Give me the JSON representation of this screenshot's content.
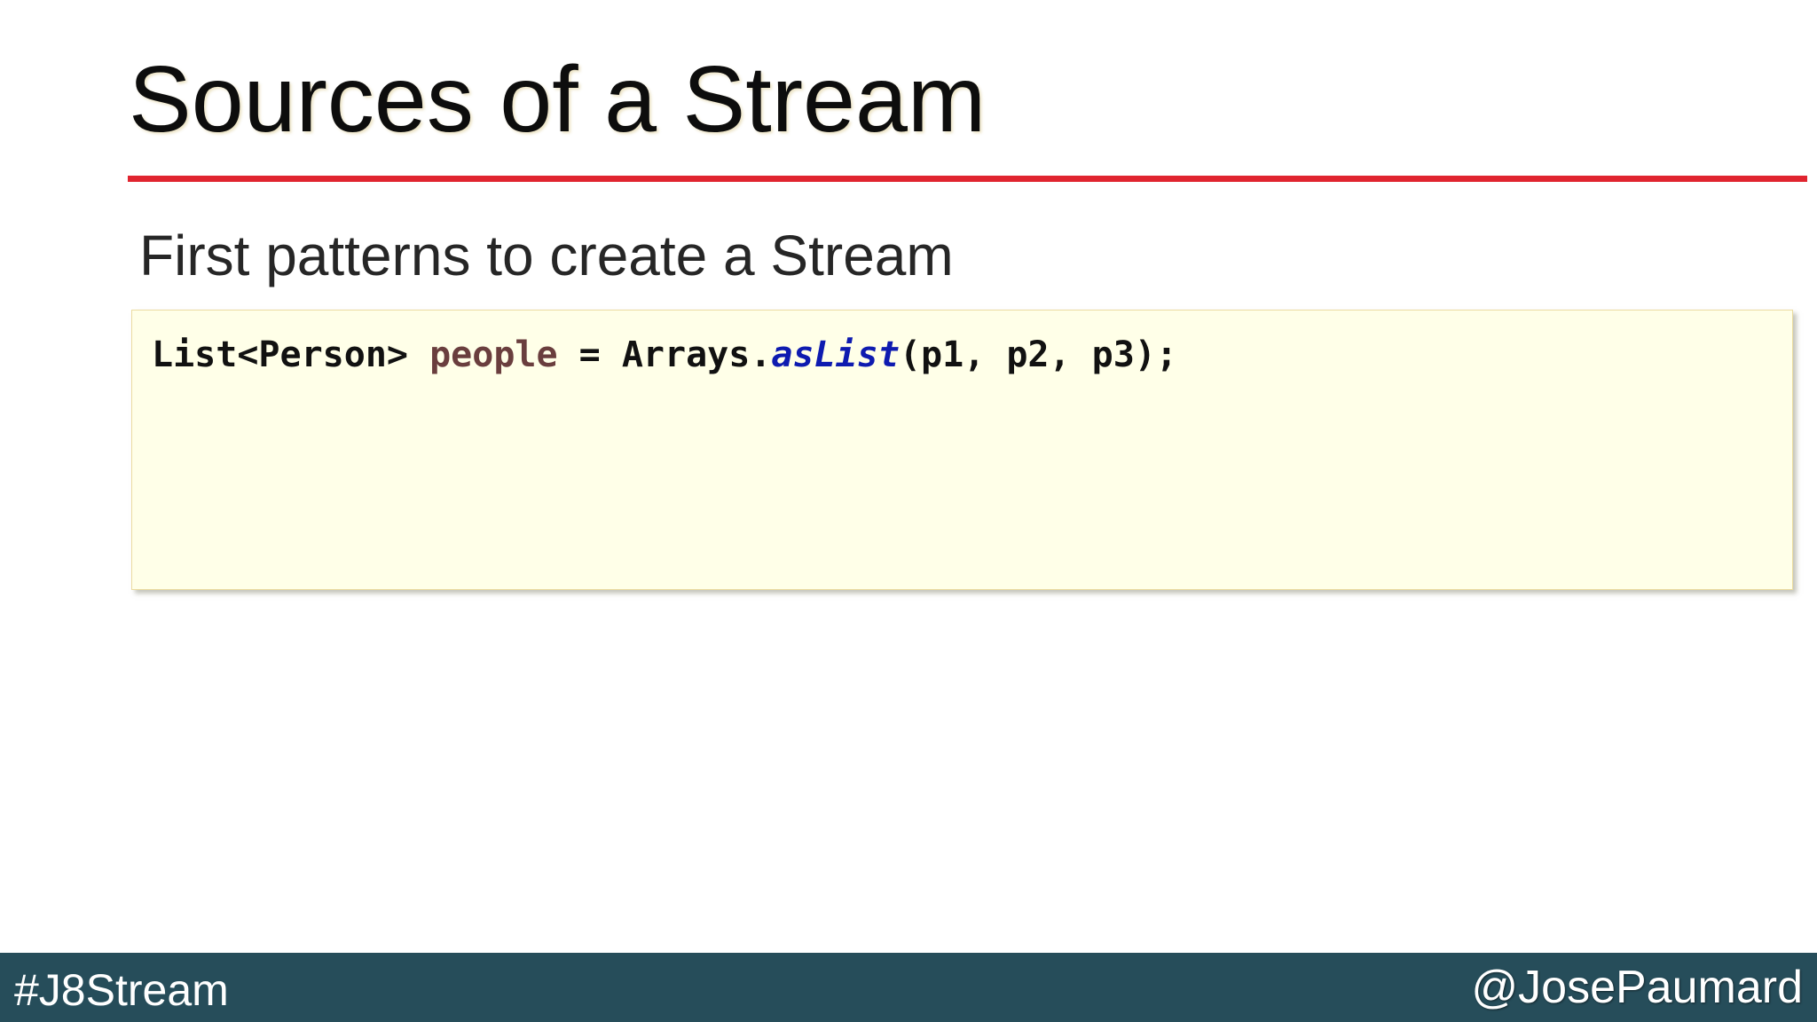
{
  "slide": {
    "title": "Sources of a Stream",
    "subtitle": "First patterns to create a Stream",
    "code": {
      "type_decl": "List<Person> ",
      "variable": "people",
      "assign": " = Arrays.",
      "method": "asList",
      "args": "(p1, p2, p3);"
    }
  },
  "footer": {
    "hashtag": "#J8Stream",
    "handle": "@JosePaumard"
  },
  "colors": {
    "title_rule": "#e0242f",
    "code_background": "#ffffe8",
    "code_variable": "#6a3e3e",
    "code_method": "#0e1bb0",
    "footer_background": "#264d5a"
  }
}
